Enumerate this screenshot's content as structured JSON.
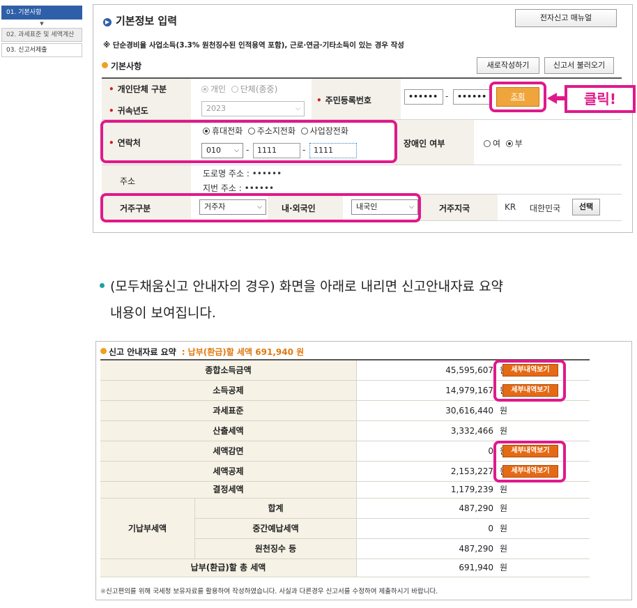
{
  "steps": [
    {
      "label": "01. 기본사항"
    },
    {
      "label": "02. 과세표준 및 세액계산"
    },
    {
      "label": "03. 신고서제출"
    }
  ],
  "form": {
    "title": "기본정보 입력",
    "manual_button": "전자신고 매뉴얼",
    "notice": "※ 단순경비율 사업소득(3.3% 원천징수된 인적용역 포함), 근로·연금·기타소득이 있는 경우 작성",
    "section_title": "기본사항",
    "new_button": "새로작성하기",
    "load_button": "신고서 불러오기",
    "entity_label": "개인단체 구분",
    "entity_opt1": "개인",
    "entity_opt2": "단체(종중)",
    "year_label": "귀속년도",
    "year_value": "2023",
    "rrn_label": "주민등록번호",
    "rrn_front": "••••••",
    "rrn_back": "••••••",
    "lookup_button": "조회",
    "callout": "클릭!",
    "contact_label": "연락처",
    "phone_opt1": "휴대전화",
    "phone_opt2": "주소지전화",
    "phone_opt3": "사업장전화",
    "phone1": "010",
    "phone2": "1111",
    "phone3": "1111",
    "disability_label": "장애인 여부",
    "disability_yes": "여",
    "disability_no": "부",
    "address_label": "주소",
    "road_address": "도로명 주소 :  ••••••",
    "lot_address": "지번 주소 :  ••••••",
    "residence_label": "거주구분",
    "residence_value": "거주자",
    "nationality_label": "내·외국인",
    "nationality_value": "내국인",
    "country_label": "거주지국",
    "country_code": "KR",
    "country_name": "대한민국",
    "select_button": "선택"
  },
  "bullet": {
    "line1": "(모두채움신고 안내자의 경우) 화면을 아래로 내리면 신고안내자료 요약",
    "line2": "내용이 보여집니다."
  },
  "summary": {
    "title": "신고 안내자료 요약",
    "headline": ": 납부(환급)할 세액 691,940 원",
    "won": "원",
    "detail_button": "세부내역보기",
    "rows": [
      {
        "label": "종합소득금액",
        "value": "45,595,607"
      },
      {
        "label": "소득공제",
        "value": "14,979,167"
      },
      {
        "label": "과세표준",
        "value": "30,616,440"
      },
      {
        "label": "산출세액",
        "value": "3,332,466"
      },
      {
        "label": "세액감면",
        "value": "0"
      },
      {
        "label": "세액공제",
        "value": "2,153,227"
      },
      {
        "label": "결정세액",
        "value": "1,179,239"
      }
    ],
    "prepaid_label": "기납부세액",
    "prepaid_rows": [
      {
        "label": "합계",
        "value": "487,290"
      },
      {
        "label": "중간예납세액",
        "value": "0"
      },
      {
        "label": "원천징수 등",
        "value": "487,290"
      }
    ],
    "total_label": "납부(환급)할 총 세액",
    "total_value": "691,940",
    "footnote": "신고편의를 위해 국세청 보유자료를 활용하여 작성하였습니다. 사실과 다른경우 신고서를 수정하여 제출하시기 바랍니다.",
    "footnote_mark": "※"
  }
}
